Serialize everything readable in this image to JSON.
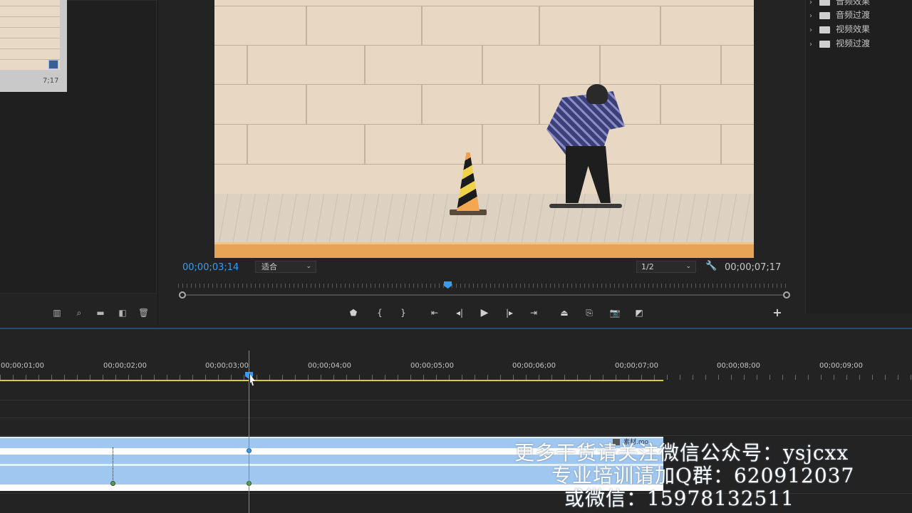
{
  "project_panel": {
    "thumb_duration": "7;17",
    "tool_icons": [
      "list-view-icon",
      "search-icon",
      "new-bin-icon",
      "new-item-icon",
      "trash-icon"
    ]
  },
  "program_monitor": {
    "timecode_current": "00;00;03;14",
    "zoom": "适合",
    "resolution": "1/2",
    "timecode_duration": "00;00;07;17",
    "playhead_progress": 0.44
  },
  "effects_panel": {
    "items": [
      {
        "label": "音频效果"
      },
      {
        "label": "音频过渡"
      },
      {
        "label": "视频效果"
      },
      {
        "label": "视频过渡"
      }
    ]
  },
  "timeline": {
    "ruler_labels": [
      "00;00;01;00",
      "00;00;02;00",
      "00;00;03;00",
      "00;00;04;00",
      "00;00;05;00",
      "00;00;06;00",
      "00;00;07;00",
      "00;00;08;00",
      "00;00;09;00"
    ],
    "clip_name": "素材.mo"
  },
  "watermark": {
    "line1": "更多干货请关注微信公众号：ysjcxx",
    "line2": "专业培训请加Q群：620912037",
    "line3": "或微信：15978132511"
  },
  "colors": {
    "accent_blue": "#3a9cf1",
    "work_area": "#d9cb3a",
    "clip": "#9fc7f0"
  }
}
